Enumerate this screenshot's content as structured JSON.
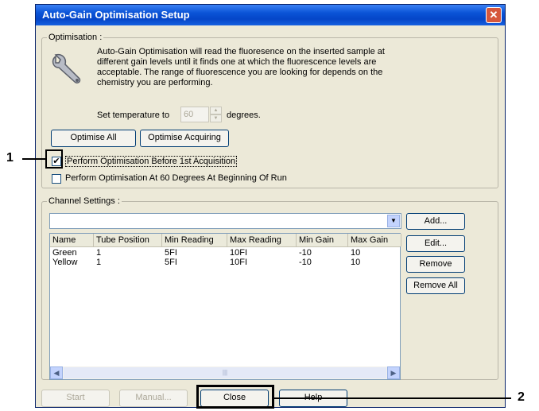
{
  "dialog": {
    "title": "Auto-Gain Optimisation Setup",
    "close_glyph": "✕",
    "optimisation_group_label": "Optimisation :",
    "description": [
      "Auto-Gain Optimisation will read the fluoresence on the inserted sample at",
      "different gain levels until it finds one at which the fluorescence levels are",
      "acceptable. The range of fluorescence you are looking for depends on the",
      "chemistry you are performing."
    ],
    "set_temp_label": "Set temperature to",
    "temperature_value": "60",
    "degrees_label": "degrees.",
    "optimise_all_label": "Optimise All",
    "optimise_acquiring_label": "Optimise Acquiring",
    "checkbox1_label": "Perform Optimisation Before 1st Acquisition",
    "checkbox1_checked": true,
    "checkbox2_label": "Perform Optimisation At 60 Degrees At Beginning Of Run",
    "checkbox2_checked": false,
    "channel_group_label": "Channel Settings :",
    "channel_dropdown_value": "",
    "columns": [
      "Name",
      "Tube Position",
      "Min Reading",
      "Max Reading",
      "Min Gain",
      "Max Gain"
    ],
    "rows": [
      [
        "Green",
        "1",
        "5FI",
        "10FI",
        "-10",
        "10"
      ],
      [
        "Yellow",
        "1",
        "5FI",
        "10FI",
        "-10",
        "10"
      ]
    ],
    "scroll_thumb": "|||",
    "side_buttons": {
      "add": "Add...",
      "edit": "Edit...",
      "remove": "Remove",
      "remove_all": "Remove All"
    },
    "footer": {
      "start": "Start",
      "manual": "Manual...",
      "close": "Close",
      "help": "Help"
    }
  },
  "callouts": {
    "one": "1",
    "two": "2"
  }
}
